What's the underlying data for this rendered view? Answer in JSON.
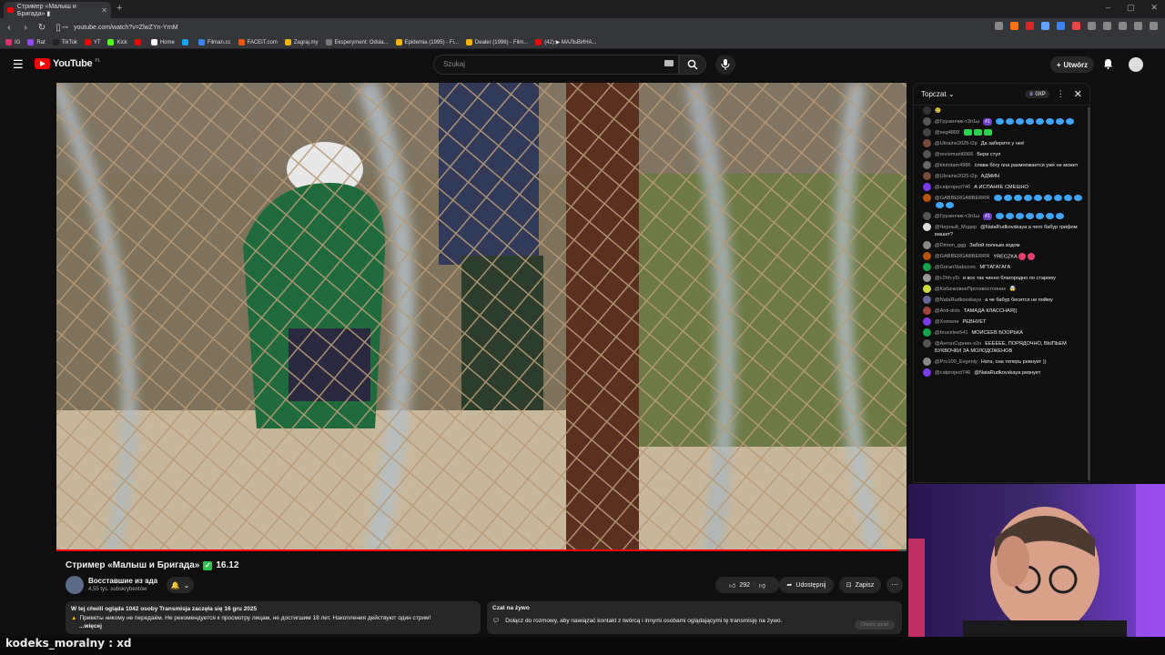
{
  "browser": {
    "tab_title": "Стример «Малыш и Бригада» ▮",
    "url": "youtube.com/watch?v=ZlwZYn-YrnM",
    "bookmarks": [
      {
        "label": "IG",
        "color": "#e1306c"
      },
      {
        "label": "Rat",
        "color": "#9147ff"
      },
      {
        "label": "TikTok",
        "color": "#222222"
      },
      {
        "label": "YT",
        "color": "#ff0000"
      },
      {
        "label": "Kick",
        "color": "#53fc18"
      },
      {
        "label": "",
        "color": "#ff0000"
      },
      {
        "label": "Home",
        "color": "#ffffff"
      },
      {
        "label": "",
        "color": "#1da1f2"
      },
      {
        "label": "Filman.cc",
        "color": "#3b82f6"
      },
      {
        "label": "FACEIT.com",
        "color": "#ff5500"
      },
      {
        "label": "Zagraj.my",
        "color": "#f5b301"
      },
      {
        "label": "Eksperyment: Odsła...",
        "color": "#777777"
      },
      {
        "label": "Epidemia (1995) - Fi...",
        "color": "#f5b301"
      },
      {
        "label": "Dealer (1996) - Film...",
        "color": "#f5b301"
      },
      {
        "label": "(42) ▶ МАЛЬВИНА...",
        "color": "#ff0000"
      }
    ]
  },
  "youtube": {
    "logo_text": "YouTube",
    "logo_region": "PL",
    "search_placeholder": "Szukaj",
    "create_label": "Utwórz"
  },
  "video": {
    "title": "Стример «Малыш и Бригада»",
    "title_suffix": "16.12",
    "channel_name": "Восставшие из ада",
    "subscribers": "4,55 tys. subskrybentów",
    "likes": "292",
    "share_label": "Udostępnij",
    "save_label": "Zapisz",
    "description_line1": "W tej chwili ogląda 1042 osoby  Transmisja zaczęła się 16 gru 2025",
    "description_line2": "Приветы никому не передаём. Не рекомендуется к просмотру лицам, не достигшим 18 лет. Накопления действуют один стрим!",
    "description_more": "...więcej",
    "progress": 0.99
  },
  "live_chat_box": {
    "title": "Czat na żywo",
    "text": "Dołącz do rozmowy, aby nawiązać kontakt z twórcą i innymi osobami oglądającymi tę transmisję na żywo.",
    "button": "Otwórz panel"
  },
  "chat": {
    "mode": "Topczat",
    "xp": "0XP",
    "messages": [
      {
        "author": "",
        "text": "",
        "emoji": "😢",
        "avatar": "#333333"
      },
      {
        "author": "@Грузенчик-т3п1ы",
        "badge": "#1",
        "text": "",
        "blue_emotes": 8,
        "avatar": "#555555"
      },
      {
        "author": "@seg4809",
        "text": "",
        "green_emotes": 3,
        "avatar": "#444444"
      },
      {
        "author": "@Ukraine2025-l2p",
        "text": "Да заберите у неё",
        "avatar": "#7a4a3a"
      },
      {
        "author": "@reviemarii6066",
        "text": "Бери стул",
        "avatar": "#555555"
      },
      {
        "author": "@ktototam4986",
        "text": "слава богу она размножается уже не может",
        "avatar": "#666666"
      },
      {
        "author": "@Ukraine2025-l2p",
        "text": "АДМИН",
        "avatar": "#7a4a3a"
      },
      {
        "author": "@catproject746",
        "text": "А ИСПАНКЕ СМЕШНО",
        "avatar": "#7c3aed"
      },
      {
        "author": "@GABBERGABBERRR",
        "text": "",
        "blue_emotes": 11,
        "avatar": "#b45309"
      },
      {
        "author": "@Грузенчик-т3п1ы",
        "badge": "#1",
        "text": "",
        "blue_emotes": 7,
        "avatar": "#555555"
      },
      {
        "author": "@Черный_Модер",
        "text": "@NataRudkovskaya а чего бабур грифом машет?",
        "avatar": "#dddddd"
      },
      {
        "author": "@Dimon_ggg",
        "text": "Забой полным ходом",
        "avatar": "#888888"
      },
      {
        "author": "@GABBERGABBERRR",
        "text": "YRECZKA",
        "red_emotes": 2,
        "avatar": "#b45309"
      },
      {
        "author": "@GoranStabcovic",
        "text": "МГТАГАГАГА",
        "avatar": "#16a34a"
      },
      {
        "author": "@c2hh-y5i",
        "text": "и все так чинно благородно по старому",
        "avatar": "#999999"
      },
      {
        "author": "@КабачковоеПротивостояние",
        "text": "",
        "emoji": "🤯",
        "avatar": "#cddc39"
      },
      {
        "author": "@NataRudkovskaya",
        "text": "а че бабур бесится не пойму",
        "avatar": "#666699"
      },
      {
        "author": "@Anti-dots",
        "text": "ТАМАДА КЛАССНАЯ))",
        "avatar": "#a0413c"
      },
      {
        "author": "@Xomene",
        "text": "РЕВНУЕТ",
        "avatar": "#7c3aed"
      },
      {
        "author": "@brucelee541",
        "text": "МОИСЕЕВ БООРЬКА",
        "avatar": "#16a34a"
      },
      {
        "author": "@АнтонСурнин-х2н",
        "text": "ЕЕЕЕЕЕ, ПОРЯДОЧНО, ВЫПЬЕМ БУКВОЧКИ ЗА МОЛОДОЖЕНОВ",
        "avatar": "#555555"
      },
      {
        "author": "@Pro100_Evgeniy",
        "text": "Ната, она теперь ревнует ))",
        "avatar": "#888888"
      },
      {
        "author": "@catproject746",
        "text": "@NataRudkovskaya ревнует",
        "avatar": "#7c3aed"
      }
    ]
  },
  "overlay": {
    "user": "kodeks_moralny",
    "separator": ":",
    "message": "xd"
  }
}
